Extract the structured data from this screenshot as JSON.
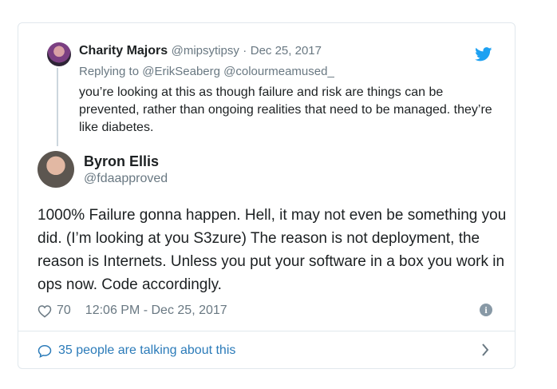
{
  "parent_tweet": {
    "name": "Charity Majors",
    "handle": "@mipsytipsy",
    "separator": "·",
    "date": "Dec 25, 2017",
    "reply_prefix": "Replying to",
    "reply_handles": "@ErikSeaberg @colourmeamused_",
    "text": "you’re looking at this as though failure and risk are things can be prevented, rather than ongoing realities that need to be managed. they’re like diabetes."
  },
  "main_tweet": {
    "name": "Byron Ellis",
    "handle": "@fdaapproved",
    "text": "1000% Failure gonna happen. Hell, it may not even be something you did. (I’m looking at you S3zure) The reason is not deployment, the reason is Internets. Unless you put your software in a box you work in ops now. Code accordingly.",
    "likes": "70",
    "timestamp": "12:06 PM - Dec 25, 2017"
  },
  "footer": {
    "talking": "35 people are talking about this"
  },
  "icons": {
    "brand": "twitter-bird-icon",
    "like": "heart-icon",
    "info": "info-icon",
    "reply": "speech-bubble-icon",
    "more": "chevron-right-icon"
  },
  "colors": {
    "link": "#2b7bb9",
    "muted": "#697882",
    "twitter_blue": "#1da1f2",
    "border": "#e1e8ed"
  }
}
